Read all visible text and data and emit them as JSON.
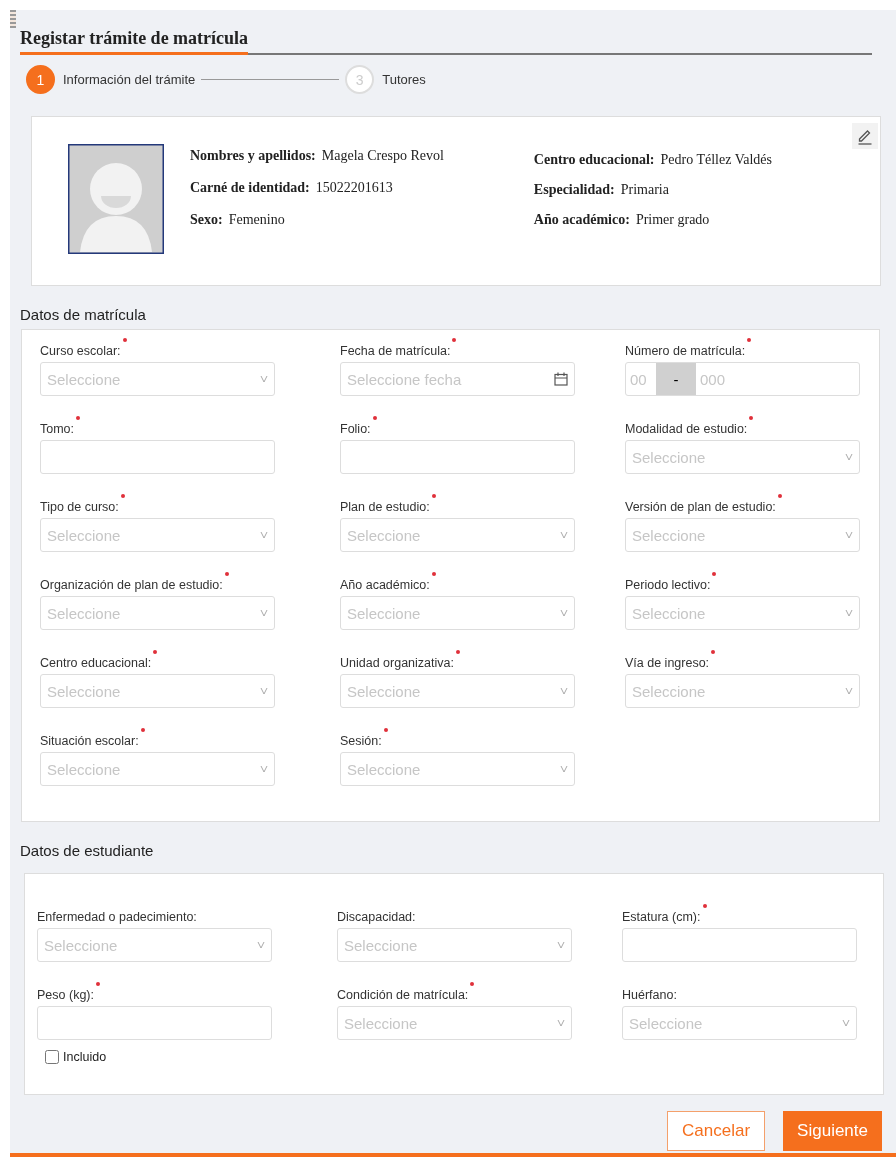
{
  "title": "Registar trámite de matrícula",
  "steps": [
    {
      "number": "1",
      "label": "Información del trámite",
      "selected": true
    },
    {
      "number": "3",
      "label": "Tutores",
      "selected": false
    }
  ],
  "profile": {
    "left": [
      {
        "label": "Nombres y apellidos:",
        "value": "Magela Crespo Revol"
      },
      {
        "label": "Carné de identidad:",
        "value": "15022201613"
      },
      {
        "label": "Sexo:",
        "value": "Femenino"
      }
    ],
    "right": [
      {
        "label": "Centro educacional:",
        "value": "Pedro Téllez Valdés"
      },
      {
        "label": "Especialidad:",
        "value": "Primaria"
      },
      {
        "label": "Año académico:",
        "value": "Primer grado"
      }
    ]
  },
  "sections": [
    {
      "title": "Datos de matrícula",
      "fields": [
        {
          "kind": "select",
          "label": "Curso escolar:",
          "required": true,
          "placeholder": "Seleccione"
        },
        {
          "kind": "date",
          "label": "Fecha de matrícula:",
          "required": true,
          "placeholder": "Seleccione fecha"
        },
        {
          "kind": "number",
          "label": "Número de matrícula:",
          "required": true,
          "placeholder": "00",
          "separator": "-",
          "placeholder_2": "000"
        },
        {
          "kind": "text",
          "label": "Tomo:",
          "required": true
        },
        {
          "kind": "text",
          "label": "Folio:",
          "required": true
        },
        {
          "kind": "select",
          "label": "Modalidad de estudio:",
          "required": true,
          "placeholder": "Seleccione"
        },
        {
          "kind": "select",
          "label": "Tipo de curso:",
          "required": true,
          "placeholder": "Seleccione"
        },
        {
          "kind": "select",
          "label": "Plan de estudio:",
          "required": true,
          "placeholder": "Seleccione"
        },
        {
          "kind": "select",
          "label": "Versión de plan de estudio:",
          "required": true,
          "placeholder": "Seleccione"
        },
        {
          "kind": "select",
          "label": "Organización de plan de estudio:",
          "required": true,
          "placeholder": "Seleccione"
        },
        {
          "kind": "select",
          "label": "Año académico:",
          "required": true,
          "placeholder": "Seleccione"
        },
        {
          "kind": "select",
          "label": "Periodo lectivo:",
          "required": true,
          "placeholder": "Seleccione"
        },
        {
          "kind": "select",
          "label": "Centro educacional:",
          "required": true,
          "placeholder": "Seleccione"
        },
        {
          "kind": "select",
          "label": "Unidad organizativa:",
          "required": true,
          "placeholder": "Seleccione"
        },
        {
          "kind": "select",
          "label": "Vía de ingreso:",
          "required": true,
          "placeholder": "Seleccione"
        },
        {
          "kind": "select",
          "label": "Situación escolar:",
          "required": true,
          "placeholder": "Seleccione"
        },
        {
          "kind": "select",
          "label": "Sesión:",
          "required": true,
          "placeholder": "Seleccione"
        }
      ]
    },
    {
      "title": "Datos de estudiante",
      "fields": [
        {
          "kind": "select",
          "label": "Enfermedad o padecimiento:",
          "required": false,
          "placeholder": "Seleccione"
        },
        {
          "kind": "select",
          "label": "Discapacidad:",
          "required": false,
          "placeholder": "Seleccione"
        },
        {
          "kind": "text",
          "label": "Estatura (cm):",
          "required": true
        },
        {
          "kind": "text",
          "label": "Peso (kg):",
          "required": true
        },
        {
          "kind": "select",
          "label": "Condición de matrícula:",
          "required": true,
          "placeholder": "Seleccione"
        },
        {
          "kind": "select",
          "label": "Huérfano:",
          "required": false,
          "placeholder": "Seleccione"
        },
        {
          "kind": "checkbox",
          "label": "Incluido",
          "checked": false
        }
      ]
    }
  ],
  "buttons": [
    {
      "kind": "secondary",
      "label": "Cancelar"
    },
    {
      "kind": "primary",
      "label": "Siguiente"
    }
  ]
}
